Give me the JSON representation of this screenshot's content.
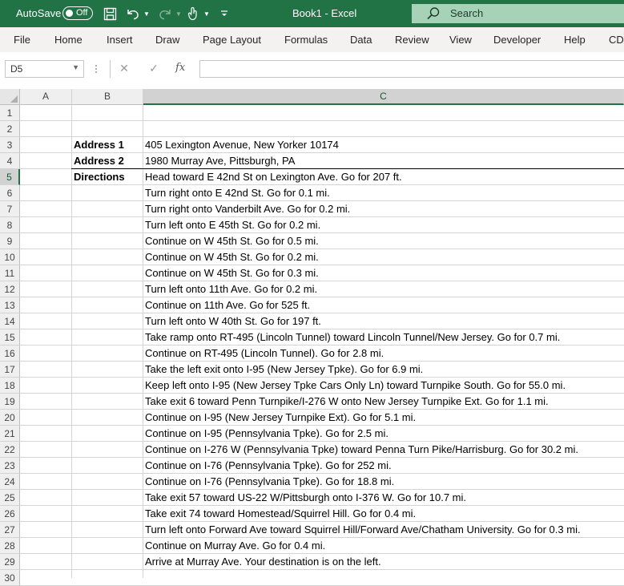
{
  "titlebar": {
    "autosave_label": "AutoSave",
    "autosave_state": "Off",
    "doc_title": "Book1  -  Excel",
    "search_placeholder": "Search"
  },
  "ribbon": {
    "tabs": [
      "File",
      "Home",
      "Insert",
      "Draw",
      "Page Layout",
      "Formulas",
      "Data",
      "Review",
      "View",
      "Developer",
      "Help",
      "CD>"
    ]
  },
  "formula_bar": {
    "name_box": "D5",
    "formula": ""
  },
  "columns": [
    "A",
    "B",
    "C"
  ],
  "active_column": "C",
  "active_row": "5",
  "rows": [
    {
      "n": "1",
      "b": "",
      "c": ""
    },
    {
      "n": "2",
      "b": "",
      "c": ""
    },
    {
      "n": "3",
      "b": "Address 1",
      "c": "405 Lexington Avenue, New Yorker 10174"
    },
    {
      "n": "4",
      "b": "Address 2",
      "c": "1980 Murray Ave, Pittsburgh, PA"
    },
    {
      "n": "5",
      "b": "Directions",
      "c": "Head toward E 42nd St on Lexington Ave. Go for 207 ft."
    },
    {
      "n": "6",
      "b": "",
      "c": "Turn right onto E 42nd St. Go for 0.1 mi."
    },
    {
      "n": "7",
      "b": "",
      "c": "Turn right onto Vanderbilt Ave. Go for 0.2 mi."
    },
    {
      "n": "8",
      "b": "",
      "c": "Turn left onto E 45th St. Go for 0.2 mi."
    },
    {
      "n": "9",
      "b": "",
      "c": "Continue on W 45th St. Go for 0.5 mi."
    },
    {
      "n": "10",
      "b": "",
      "c": "Continue on W 45th St. Go for 0.2 mi."
    },
    {
      "n": "11",
      "b": "",
      "c": "Continue on W 45th St. Go for 0.3 mi."
    },
    {
      "n": "12",
      "b": "",
      "c": "Turn left onto 11th Ave. Go for 0.2 mi."
    },
    {
      "n": "13",
      "b": "",
      "c": "Continue on 11th Ave. Go for 525 ft."
    },
    {
      "n": "14",
      "b": "",
      "c": "Turn left onto W 40th St. Go for 197 ft."
    },
    {
      "n": "15",
      "b": "",
      "c": "Take ramp onto RT-495 (Lincoln Tunnel) toward Lincoln Tunnel/New Jersey. Go for 0.7 mi."
    },
    {
      "n": "16",
      "b": "",
      "c": "Continue on RT-495 (Lincoln Tunnel). Go for 2.8 mi."
    },
    {
      "n": "17",
      "b": "",
      "c": "Take the left exit onto I-95 (New Jersey Tpke). Go for 6.9 mi."
    },
    {
      "n": "18",
      "b": "",
      "c": "Keep left onto I-95 (New Jersey Tpke Cars Only Ln) toward Turnpike South. Go for 55.0 mi."
    },
    {
      "n": "19",
      "b": "",
      "c": "Take exit 6 toward Penn Turnpike/I-276 W onto New Jersey Turnpike Ext. Go for 1.1 mi."
    },
    {
      "n": "20",
      "b": "",
      "c": "Continue on I-95 (New Jersey Turnpike Ext). Go for 5.1 mi."
    },
    {
      "n": "21",
      "b": "",
      "c": "Continue on I-95 (Pennsylvania Tpke). Go for 2.5 mi."
    },
    {
      "n": "22",
      "b": "",
      "c": "Continue on I-276 W (Pennsylvania Tpke) toward Penna Turn Pike/Harrisburg. Go for 30.2 mi."
    },
    {
      "n": "23",
      "b": "",
      "c": "Continue on I-76 (Pennsylvania Tpke). Go for 252 mi."
    },
    {
      "n": "24",
      "b": "",
      "c": "Continue on I-76 (Pennsylvania Tpke). Go for 18.8 mi."
    },
    {
      "n": "25",
      "b": "",
      "c": "Take exit 57 toward US-22 W/Pittsburgh onto I-376 W. Go for 10.7 mi."
    },
    {
      "n": "26",
      "b": "",
      "c": "Take exit 74 toward Homestead/Squirrel Hill. Go for 0.4 mi."
    },
    {
      "n": "27",
      "b": "",
      "c": "Turn left onto Forward Ave toward Squirrel Hill/Forward Ave/Chatham University. Go for 0.3 mi."
    },
    {
      "n": "28",
      "b": "",
      "c": "Continue on Murray Ave. Go for 0.4 mi."
    },
    {
      "n": "29",
      "b": "",
      "c": "Arrive at Murray Ave. Your destination is on the left."
    },
    {
      "n": "30",
      "b": "",
      "c": ""
    }
  ],
  "bold_column": "B",
  "colors": {
    "titlebar": "#217346",
    "search": "#a6d2b7",
    "ribbon": "#f3f2f1",
    "accent": "#217346"
  },
  "icons": [
    "toggle-switch",
    "save-icon",
    "undo-icon",
    "redo-icon",
    "touch-mode-icon",
    "customize-qat-icon",
    "search-icon",
    "cancel-icon",
    "enter-icon",
    "fx-icon",
    "select-all-triangle"
  ]
}
